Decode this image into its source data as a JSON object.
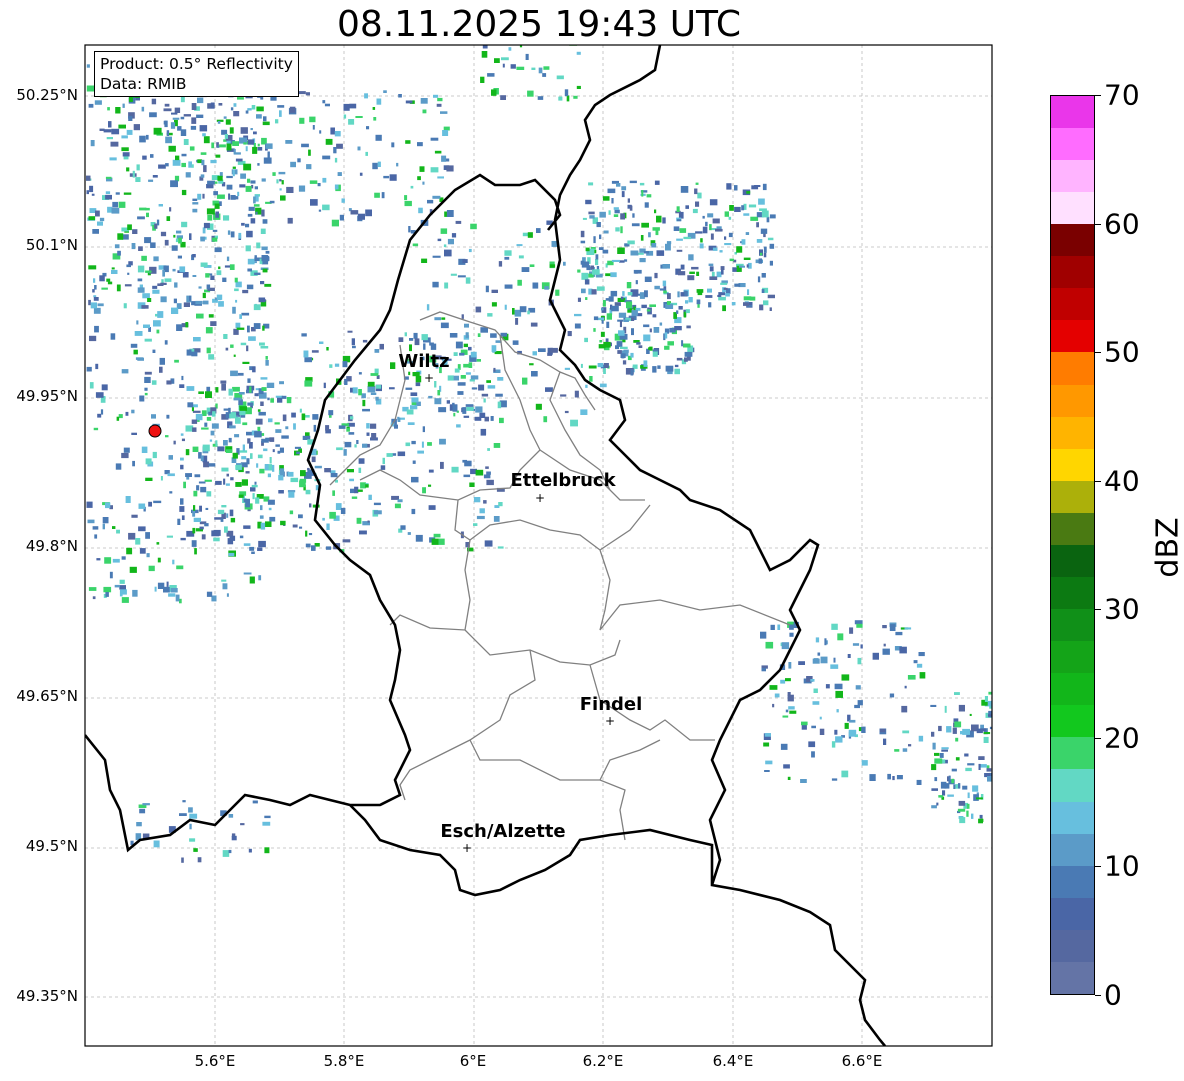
{
  "title": "08.11.2025 19:43 UTC",
  "info": {
    "product": "Product: 0.5° Reflectivity",
    "data": "Data: RMIB"
  },
  "lat_ticks": [
    "50.25°N",
    "50.1°N",
    "49.95°N",
    "49.8°N",
    "49.65°N",
    "49.5°N",
    "49.35°N"
  ],
  "lon_ticks": [
    "5.6°E",
    "5.8°E",
    "6°E",
    "6.2°E",
    "6.4°E",
    "6.6°E"
  ],
  "cities": [
    {
      "name": "Wiltz"
    },
    {
      "name": "Ettelbruck"
    },
    {
      "name": "Findel"
    },
    {
      "name": "Esch/Alzette"
    }
  ],
  "colorbar": {
    "label": "dBZ",
    "ticks": [
      "0",
      "10",
      "20",
      "30",
      "40",
      "50",
      "60",
      "70"
    ],
    "colors": [
      "#6474a6",
      "#5568a0",
      "#4a66a6",
      "#4a7ab4",
      "#5b9bc8",
      "#67bfde",
      "#62d8c4",
      "#3ad46a",
      "#12c81e",
      "#12b61a",
      "#14a418",
      "#109018",
      "#0c7a12",
      "#0a6410",
      "#4a7a12",
      "#acb00a",
      "#ffd600",
      "#ffb400",
      "#ff9800",
      "#ff7c00",
      "#e40000",
      "#c00000",
      "#a00000",
      "#7a0000",
      "#ffe0ff",
      "#ffb4ff",
      "#ff6cff",
      "#ea36ea"
    ]
  },
  "radar_site": {
    "color": "#ee1111"
  }
}
